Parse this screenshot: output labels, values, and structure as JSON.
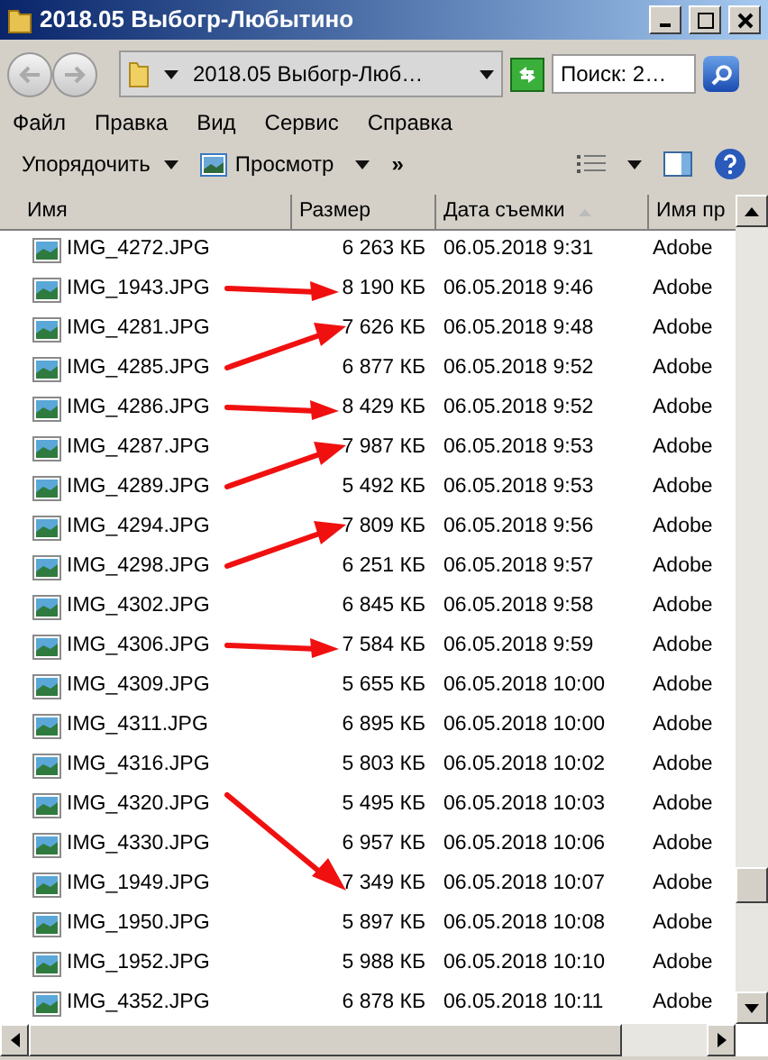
{
  "window": {
    "title": "2018.05 Выбогр-Любытино"
  },
  "address": {
    "shown": "2018.05 Выбогр-Люб…"
  },
  "search": {
    "placeholder": "Поиск: 2…"
  },
  "menu": [
    "Файл",
    "Правка",
    "Вид",
    "Сервис",
    "Справка"
  ],
  "toolbar": [
    "Упорядочить",
    "Просмотр",
    "»"
  ],
  "columns": [
    "Имя",
    "Размер",
    "Дата съемки",
    "Имя пр"
  ],
  "rows": [
    {
      "name": "IMG_4272.JPG",
      "size": "6 263 КБ",
      "date": "06.05.2018 9:31",
      "col4": "Adobe"
    },
    {
      "name": "IMG_1943.JPG",
      "size": "8 190 КБ",
      "date": "06.05.2018 9:46",
      "col4": "Adobe",
      "arrow": true,
      "kind": "flat"
    },
    {
      "name": "IMG_4281.JPG",
      "size": "7 626 КБ",
      "date": "06.05.2018 9:48",
      "col4": "Adobe",
      "arrow": true,
      "kind": "rise"
    },
    {
      "name": "IMG_4285.JPG",
      "size": "6 877 КБ",
      "date": "06.05.2018 9:52",
      "col4": "Adobe"
    },
    {
      "name": "IMG_4286.JPG",
      "size": "8 429 КБ",
      "date": "06.05.2018 9:52",
      "col4": "Adobe",
      "arrow": true,
      "kind": "flat"
    },
    {
      "name": "IMG_4287.JPG",
      "size": "7 987 КБ",
      "date": "06.05.2018 9:53",
      "col4": "Adobe",
      "arrow": true,
      "kind": "rise"
    },
    {
      "name": "IMG_4289.JPG",
      "size": "5 492 КБ",
      "date": "06.05.2018 9:53",
      "col4": "Adobe"
    },
    {
      "name": "IMG_4294.JPG",
      "size": "7 809 КБ",
      "date": "06.05.2018 9:56",
      "col4": "Adobe",
      "arrow": true,
      "kind": "rise"
    },
    {
      "name": "IMG_4298.JPG",
      "size": "6 251 КБ",
      "date": "06.05.2018 9:57",
      "col4": "Adobe"
    },
    {
      "name": "IMG_4302.JPG",
      "size": "6 845 КБ",
      "date": "06.05.2018 9:58",
      "col4": "Adobe"
    },
    {
      "name": "IMG_4306.JPG",
      "size": "7 584 КБ",
      "date": "06.05.2018 9:59",
      "col4": "Adobe",
      "arrow": true,
      "kind": "flat"
    },
    {
      "name": "IMG_4309.JPG",
      "size": "5 655 КБ",
      "date": "06.05.2018 10:00",
      "col4": "Adobe"
    },
    {
      "name": "IMG_4311.JPG",
      "size": "6 895 КБ",
      "date": "06.05.2018 10:00",
      "col4": "Adobe"
    },
    {
      "name": "IMG_4316.JPG",
      "size": "5 803 КБ",
      "date": "06.05.2018 10:02",
      "col4": "Adobe"
    },
    {
      "name": "IMG_4320.JPG",
      "size": "5 495 КБ",
      "date": "06.05.2018 10:03",
      "col4": "Adobe"
    },
    {
      "name": "IMG_4330.JPG",
      "size": "6 957 КБ",
      "date": "06.05.2018 10:06",
      "col4": "Adobe"
    },
    {
      "name": "IMG_1949.JPG",
      "size": "7 349 КБ",
      "date": "06.05.2018 10:07",
      "col4": "Adobe",
      "arrow": true,
      "kind": "fall"
    },
    {
      "name": "IMG_1950.JPG",
      "size": "5 897 КБ",
      "date": "06.05.2018 10:08",
      "col4": "Adobe"
    },
    {
      "name": "IMG_1952.JPG",
      "size": "5 988 КБ",
      "date": "06.05.2018 10:10",
      "col4": "Adobe"
    },
    {
      "name": "IMG_4352.JPG",
      "size": "6 878 КБ",
      "date": "06.05.2018 10:11",
      "col4": "Adobe"
    }
  ]
}
